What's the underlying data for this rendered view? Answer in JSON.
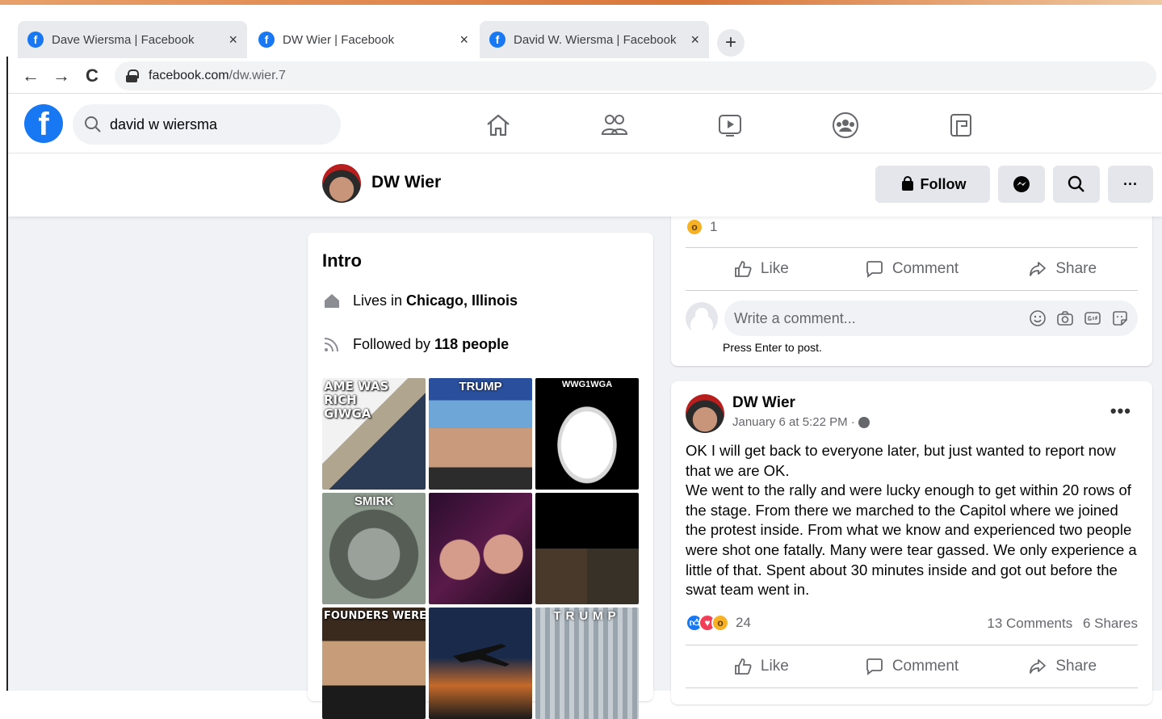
{
  "browser": {
    "tabs": [
      {
        "title": "Dave Wiersma | Facebook",
        "favicon": "facebook-favicon",
        "close": "×",
        "active": false
      },
      {
        "title": "DW Wier | Facebook",
        "favicon": "facebook-favicon",
        "close": "×",
        "active": true
      },
      {
        "title": "David W. Wiersma | Facebook",
        "favicon": "facebook-favicon",
        "close": "×",
        "active": false
      }
    ],
    "new_tab": "+",
    "back": "←",
    "forward": "→",
    "reload": "C",
    "url_host": "facebook.com",
    "url_path": "/dw.wier.7"
  },
  "fb": {
    "logo": "f",
    "search_value": "david w wiersma",
    "nav_icons": [
      "home-icon",
      "friends-icon",
      "watch-icon",
      "groups-icon",
      "gaming-icon"
    ]
  },
  "profile": {
    "name": "DW Wier",
    "follow_label": "Follow",
    "messenger_icon": "messenger-icon",
    "search_icon": "search-icon",
    "more_label": "···"
  },
  "intro": {
    "title": "Intro",
    "lives_prefix": "Lives in",
    "lives_place": "Chicago, Illinois",
    "followed_prefix": "Followed by",
    "followed_count": "118 people",
    "photos": [
      {
        "caption": "AME WAS\nRICH\nGIWGA"
      },
      {
        "caption": "TRUMP"
      },
      {
        "caption": "WWG1WGA"
      },
      {
        "caption": "SMIRK"
      },
      {
        "caption": ""
      },
      {
        "caption": ""
      },
      {
        "caption": "FOUNDERS WERE BA"
      },
      {
        "caption": ""
      },
      {
        "caption": "TRUMP"
      }
    ]
  },
  "post1": {
    "reaction_count": "1",
    "like": "Like",
    "comment": "Comment",
    "share": "Share",
    "comment_placeholder": "Write a comment...",
    "hint": "Press Enter to post."
  },
  "post2": {
    "author": "DW Wier",
    "timestamp": "January 6 at 5:22 PM ·",
    "more": "•••",
    "text_lines": [
      "OK I will get back to everyone later, but just wanted to report now that we are OK.",
      "We went to the rally and were lucky enough to get within 20 rows of the stage. From there we marched to the Capitol where we joined the protest inside. From what we know and experienced two people were shot one fatally. Many were tear gassed. We only experience a little of that. Spent about 30 minutes inside and got out before the swat team went in."
    ],
    "reaction_count": "24",
    "comments_count": "13 Comments",
    "shares_count": "6 Shares",
    "like": "Like",
    "comment": "Comment",
    "share": "Share"
  },
  "colors": {
    "fb_blue": "#1877f2",
    "feed_bg": "#f0f2f5",
    "secondary_text": "#65676b",
    "love_red": "#f33e58",
    "wow_yellow": "#f7b125"
  }
}
